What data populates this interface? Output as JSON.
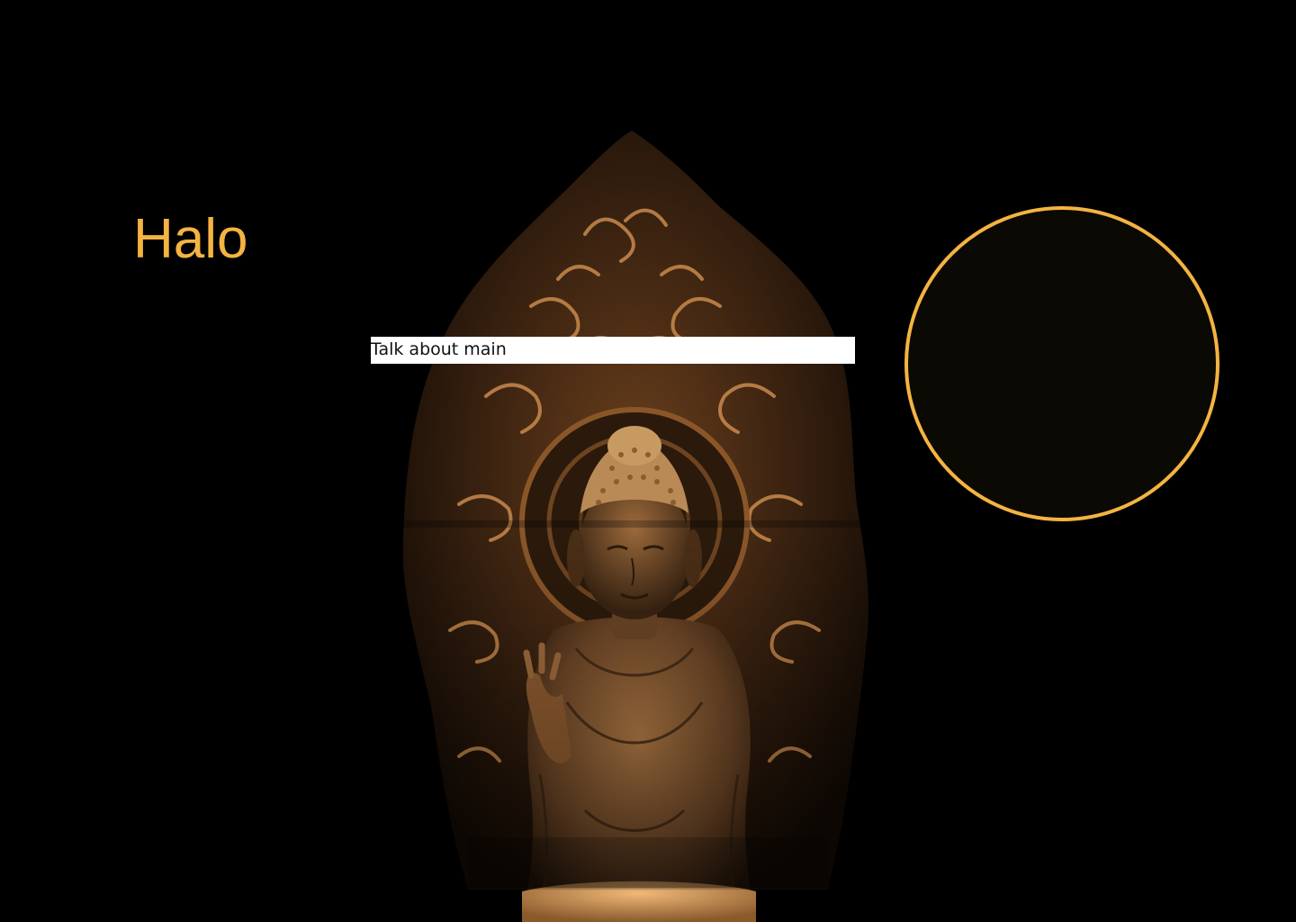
{
  "page": {
    "title": "Halo",
    "caption": "Talk about main"
  },
  "image": {
    "subject": "buddha-statue-icon"
  },
  "colors": {
    "background": "#000000",
    "accent": "#f4b342",
    "circle_fill": "#0b0904",
    "caption_bg": "#ffffff"
  }
}
